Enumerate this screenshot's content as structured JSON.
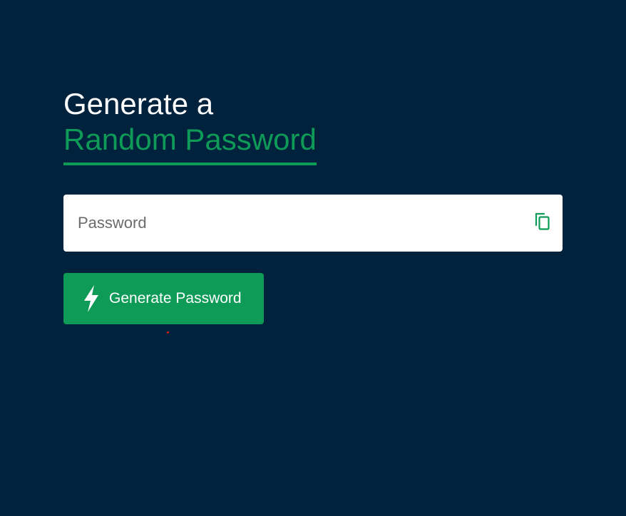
{
  "heading": {
    "line1": "Generate a",
    "line2": "Random Password"
  },
  "password_field": {
    "value": "",
    "placeholder": "Password",
    "copy_icon": "copy-icon"
  },
  "generate_button": {
    "label": "Generate Password",
    "icon": "lightning-bolt-icon"
  },
  "colors": {
    "background": "#01223d",
    "accent": "#0e9b57",
    "text_light": "#ffffff",
    "cursor_dot": "#e0201b"
  }
}
